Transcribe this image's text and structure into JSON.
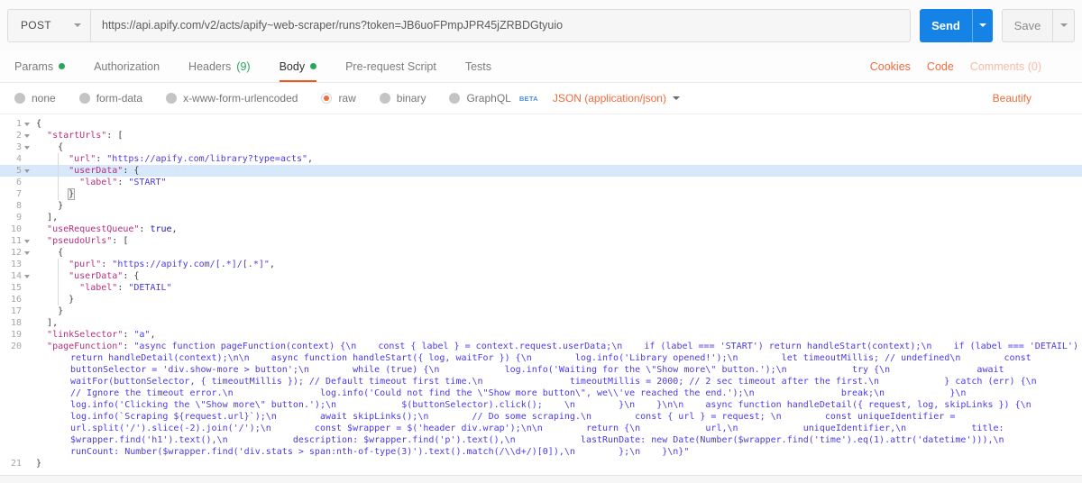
{
  "colors": {
    "orange": "#F26B3A",
    "orange_deep": "#F0571F",
    "blue": "#1583E6",
    "green": "#2AA65C",
    "beta_blue": "#4A90E2",
    "key": "#B92D7D",
    "string": "#4A3BE5",
    "atom": "#1C1CA8",
    "active_line": "#D7E8FA"
  },
  "request": {
    "method": "POST",
    "url": "https://api.apify.com/v2/acts/apify~web-scraper/runs?token=JB6uoFPmpJPR45jZRBDGtyuio",
    "send_label": "Send",
    "save_label": "Save"
  },
  "tabs": {
    "items": [
      {
        "id": "params",
        "label": "Params",
        "dot": true
      },
      {
        "id": "authorization",
        "label": "Authorization"
      },
      {
        "id": "headers",
        "label": "Headers",
        "suffix": "(9)"
      },
      {
        "id": "body",
        "label": "Body",
        "dot": true,
        "active": true
      },
      {
        "id": "pre-request-script",
        "label": "Pre-request Script"
      },
      {
        "id": "tests",
        "label": "Tests"
      }
    ],
    "links": [
      {
        "id": "cookies",
        "label": "Cookies"
      },
      {
        "id": "code",
        "label": "Code"
      },
      {
        "id": "comments",
        "label": "Comments (0)",
        "muted": true
      }
    ]
  },
  "body_options": {
    "radios": [
      {
        "id": "none",
        "label": "none"
      },
      {
        "id": "form-data",
        "label": "form-data"
      },
      {
        "id": "x-www-form-urlencoded",
        "label": "x-www-form-urlencoded"
      },
      {
        "id": "raw",
        "label": "raw",
        "selected": true
      },
      {
        "id": "binary",
        "label": "binary"
      },
      {
        "id": "graphql",
        "label": "GraphQL",
        "beta": "BETA"
      }
    ],
    "content_type": "JSON (application/json)",
    "beautify_label": "Beautify"
  },
  "editor": {
    "lines": [
      {
        "n": 1,
        "fold": true,
        "tokens": [
          {
            "t": "pun",
            "v": "{"
          }
        ]
      },
      {
        "n": 2,
        "fold": true,
        "tokens": [
          {
            "t": "w",
            "v": "  "
          },
          {
            "t": "k",
            "v": "\"startUrls\""
          },
          {
            "t": "pun",
            "v": ": ["
          }
        ]
      },
      {
        "n": 3,
        "fold": true,
        "tokens": [
          {
            "t": "w",
            "v": "    "
          },
          {
            "t": "pun",
            "v": "{"
          }
        ]
      },
      {
        "n": 4,
        "tokens": [
          {
            "t": "w",
            "v": "      "
          },
          {
            "t": "k",
            "v": "\"url\""
          },
          {
            "t": "pun",
            "v": ": "
          },
          {
            "t": "s",
            "v": "\"https://apify.com/library?type=acts\""
          },
          {
            "t": "pun",
            "v": ","
          }
        ]
      },
      {
        "n": 5,
        "fold": true,
        "active": true,
        "tokens": [
          {
            "t": "w",
            "v": "      "
          },
          {
            "t": "k",
            "v": "\"userData\""
          },
          {
            "t": "pun",
            "v": ": {"
          }
        ]
      },
      {
        "n": 6,
        "tokens": [
          {
            "t": "w",
            "v": "        "
          },
          {
            "t": "k",
            "v": "\"label\""
          },
          {
            "t": "pun",
            "v": ": "
          },
          {
            "t": "s",
            "v": "\"START\""
          }
        ]
      },
      {
        "n": 7,
        "tokens": [
          {
            "t": "w",
            "v": "      "
          },
          {
            "t": "m",
            "v": "}"
          }
        ]
      },
      {
        "n": 8,
        "tokens": [
          {
            "t": "w",
            "v": "    "
          },
          {
            "t": "pun",
            "v": "}"
          }
        ]
      },
      {
        "n": 9,
        "tokens": [
          {
            "t": "w",
            "v": "  "
          },
          {
            "t": "pun",
            "v": "],"
          }
        ]
      },
      {
        "n": 10,
        "tokens": [
          {
            "t": "w",
            "v": "  "
          },
          {
            "t": "k",
            "v": "\"useRequestQueue\""
          },
          {
            "t": "pun",
            "v": ": "
          },
          {
            "t": "a",
            "v": "true"
          },
          {
            "t": "pun",
            "v": ","
          }
        ]
      },
      {
        "n": 11,
        "fold": true,
        "tokens": [
          {
            "t": "w",
            "v": "  "
          },
          {
            "t": "k",
            "v": "\"pseudoUrls\""
          },
          {
            "t": "pun",
            "v": ": ["
          }
        ]
      },
      {
        "n": 12,
        "fold": true,
        "tokens": [
          {
            "t": "w",
            "v": "    "
          },
          {
            "t": "pun",
            "v": "{"
          }
        ]
      },
      {
        "n": 13,
        "tokens": [
          {
            "t": "w",
            "v": "      "
          },
          {
            "t": "k",
            "v": "\"purl\""
          },
          {
            "t": "pun",
            "v": ": "
          },
          {
            "t": "s",
            "v": "\"https://apify.com/[.*]/[.*]\""
          },
          {
            "t": "pun",
            "v": ","
          }
        ]
      },
      {
        "n": 14,
        "fold": true,
        "tokens": [
          {
            "t": "w",
            "v": "      "
          },
          {
            "t": "k",
            "v": "\"userData\""
          },
          {
            "t": "pun",
            "v": ": {"
          }
        ]
      },
      {
        "n": 15,
        "tokens": [
          {
            "t": "w",
            "v": "        "
          },
          {
            "t": "k",
            "v": "\"label\""
          },
          {
            "t": "pun",
            "v": ": "
          },
          {
            "t": "s",
            "v": "\"DETAIL\""
          }
        ]
      },
      {
        "n": 16,
        "tokens": [
          {
            "t": "w",
            "v": "      "
          },
          {
            "t": "pun",
            "v": "}"
          }
        ]
      },
      {
        "n": 17,
        "tokens": [
          {
            "t": "w",
            "v": "    "
          },
          {
            "t": "pun",
            "v": "}"
          }
        ]
      },
      {
        "n": 18,
        "tokens": [
          {
            "t": "w",
            "v": "  "
          },
          {
            "t": "pun",
            "v": "],"
          }
        ]
      },
      {
        "n": 19,
        "tokens": [
          {
            "t": "w",
            "v": "  "
          },
          {
            "t": "k",
            "v": "\"linkSelector\""
          },
          {
            "t": "pun",
            "v": ": "
          },
          {
            "t": "s",
            "v": "\"a\""
          },
          {
            "t": "pun",
            "v": ","
          }
        ]
      },
      {
        "n": 20,
        "wrap": true,
        "tokens": [
          {
            "t": "w",
            "v": "  "
          },
          {
            "t": "k",
            "v": "\"pageFunction\""
          },
          {
            "t": "pun",
            "v": ": "
          },
          {
            "t": "s",
            "v": "\"async function pageFunction(context) {\\n    const { label } = context.request.userData;\\n    if (label === 'START') return handleStart(context);\\n    if (label === 'DETAIL') return handleDetail(context);\\n\\n    async function handleStart({ log, waitFor }) {\\n        log.info('Library opened!');\\n        let timeoutMillis; // undefined\\n        const buttonSelector = 'div.show-more > button';\\n        while (true) {\\n            log.info('Waiting for the \\\"Show more\\\" button.');\\n            try {\\n                await waitFor(buttonSelector, { timeoutMillis }); // Default timeout first time.\\n                timeoutMillis = 2000; // 2 sec timeout after the first.\\n            } catch (err) {\\n                // Ignore the timeout error.\\n                log.info('Could not find the \\\"Show more button\\\", we\\\\'ve reached the end.');\\n                break;\\n            }\\n            log.info('Clicking the \\\"Show more\\\" button.');\\n            $(buttonSelector).click();    \\n        }\\n    }\\n\\n    async function handleDetail({ request, log, skipLinks }) {\\n        log.info(`Scraping ${request.url}`);\\n        await skipLinks();\\n        // Do some scraping.\\n        const { url } = request; \\n        const uniqueIdentifier = url.split('/').slice(-2).join('/');\\n        const $wrapper = $('header div.wrap');\\n\\n        return {\\n            url,\\n            uniqueIdentifier,\\n            title: $wrapper.find('h1').text(),\\n            description: $wrapper.find('p').text(),\\n            lastRunDate: new Date(Number($wrapper.find('time').eq(1).attr('datetime'))),\\n            runCount: Number($wrapper.find('div.stats > span:nth-of-type(3)').text().match(/\\\\d+/)[0]),\\n        };\\n    }\\n}\""
          }
        ]
      },
      {
        "n": 21,
        "tokens": [
          {
            "t": "pun",
            "v": "}"
          }
        ]
      }
    ]
  }
}
